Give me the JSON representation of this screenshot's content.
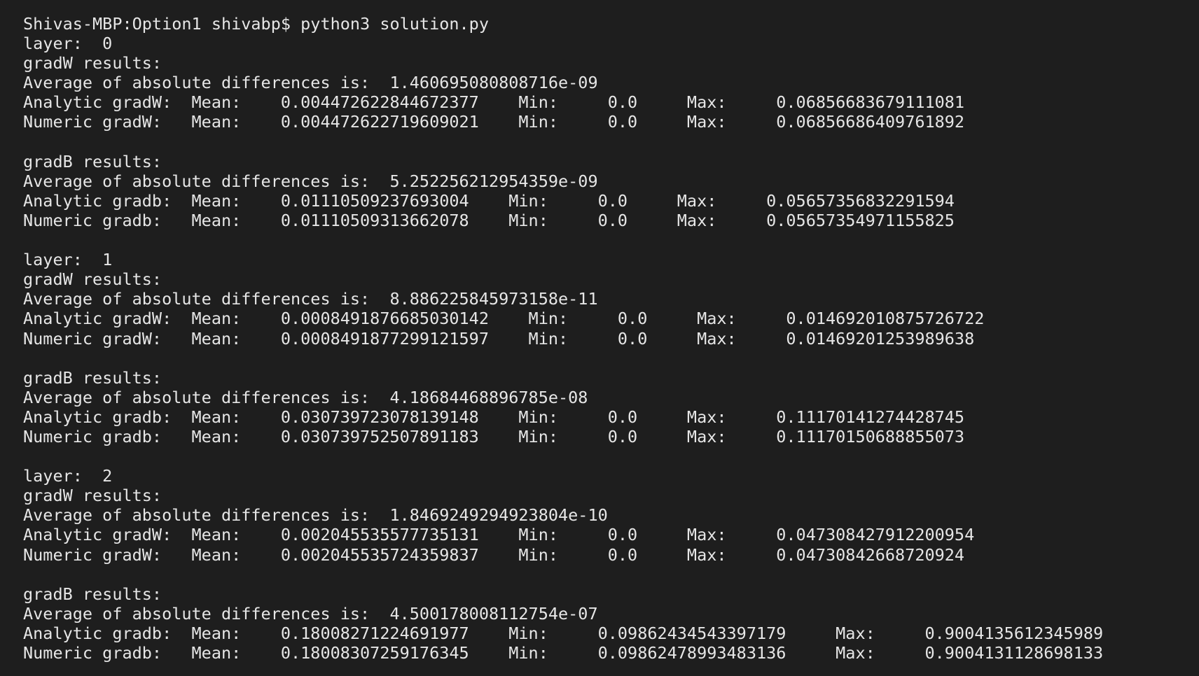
{
  "terminal": {
    "lines": [
      "Shivas-MBP:Option1 shivabp$ python3 solution.py",
      "layer:  0",
      "gradW results:",
      "Average of absolute differences is:  1.460695080808716e-09",
      "Analytic gradW:  Mean:    0.004472622844672377    Min:     0.0     Max:     0.06856683679111081",
      "Numeric gradW:   Mean:    0.004472622719609021    Min:     0.0     Max:     0.0685668640976189​2",
      "",
      "gradB results:",
      "Average of absolute differences is:  5.252256212954359e-09",
      "Analytic gradb:  Mean:    0.01110509237693004    Min:     0.0     Max:     0.05657356832291594",
      "Numeric gradb:   Mean:    0.01110509313662078    Min:     0.0     Max:     0.05657354971155825",
      "",
      "layer:  1",
      "gradW results:",
      "Average of absolute differences is:  8.886225845973158e-11",
      "Analytic gradW:  Mean:    0.0008491876685030142    Min:     0.0     Max:     0.014692010875726722",
      "Numeric gradW:   Mean:    0.0008491877299121597    Min:     0.0     Max:     0.0146920125398963​8",
      "",
      "gradB results:",
      "Average of absolute differences is:  4.186844688967​85e-08",
      "Analytic gradb:  Mean:    0.030739723078139148    Min:     0.0     Max:     0.11170141274428745",
      "Numeric gradb:   Mean:    0.030739752507891183    Min:     0.0     Max:     0.11170150688855073",
      "",
      "layer:  2",
      "gradW results:",
      "Average of absolute differences is:  1.8469249294923804e-10",
      "Analytic gradW:  Mean:    0.002045535577735131    Min:     0.0     Max:     0.047308427912200954",
      "Numeric gradW:   Mean:    0.002045535724359837    Min:     0.0     Max:     0.04730842668720924",
      "",
      "gradB results:",
      "Average of absolute differences is:  4.500178008112754e-07",
      "Analytic gradb:  Mean:    0.18008271224691977    Min:     0.09862434543397179     Max:     0.9004135612345989",
      "Numeric gradb:   Mean:    0.18008307259176345    Min:     0.09862478993483136     Max:     0.9004131128698133"
    ]
  }
}
